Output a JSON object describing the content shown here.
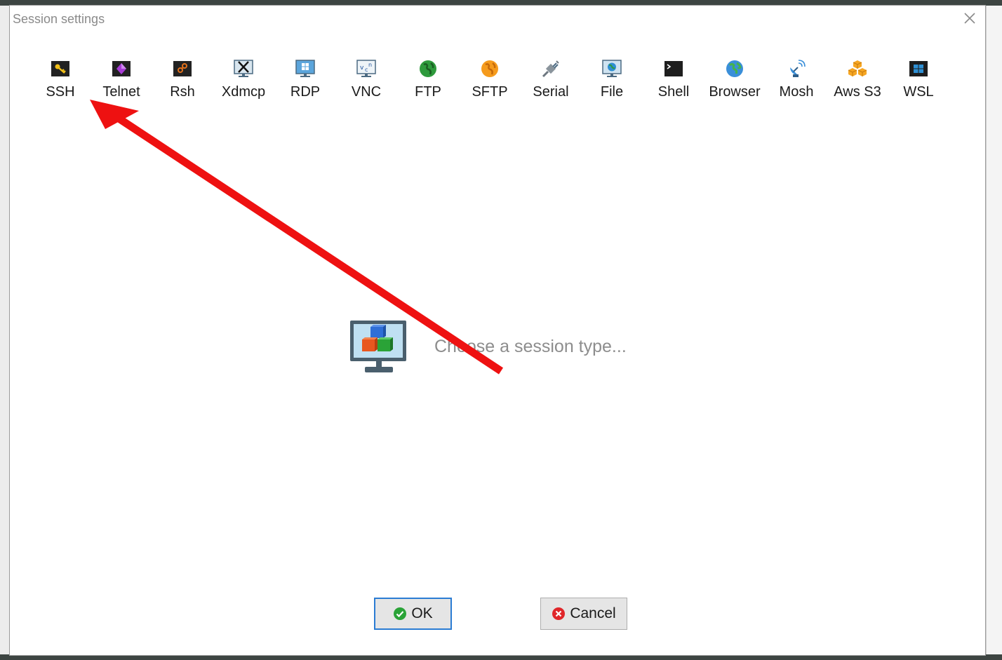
{
  "dialog": {
    "title": "Session settings",
    "close_glyph": "✕"
  },
  "session_types": [
    {
      "label": "SSH",
      "icon": "key-icon"
    },
    {
      "label": "Telnet",
      "icon": "telnet-icon"
    },
    {
      "label": "Rsh",
      "icon": "rsh-icon"
    },
    {
      "label": "Xdmcp",
      "icon": "xdmcp-icon"
    },
    {
      "label": "RDP",
      "icon": "rdp-icon"
    },
    {
      "label": "VNC",
      "icon": "vnc-icon"
    },
    {
      "label": "FTP",
      "icon": "ftp-globe-icon"
    },
    {
      "label": "SFTP",
      "icon": "sftp-globe-icon"
    },
    {
      "label": "Serial",
      "icon": "serial-plug-icon"
    },
    {
      "label": "File",
      "icon": "file-monitor-icon"
    },
    {
      "label": "Shell",
      "icon": "terminal-icon"
    },
    {
      "label": "Browser",
      "icon": "globe-icon"
    },
    {
      "label": "Mosh",
      "icon": "satellite-icon"
    },
    {
      "label": "Aws S3",
      "icon": "aws-cubes-icon"
    },
    {
      "label": "WSL",
      "icon": "windows-icon"
    }
  ],
  "main": {
    "hint": "Choose a session type..."
  },
  "buttons": {
    "ok_label": "OK",
    "cancel_label": "Cancel"
  },
  "colors": {
    "annotation_arrow": "#ee1111",
    "ok_border": "#2b7cd3",
    "hint_text": "#8d8d8d"
  }
}
